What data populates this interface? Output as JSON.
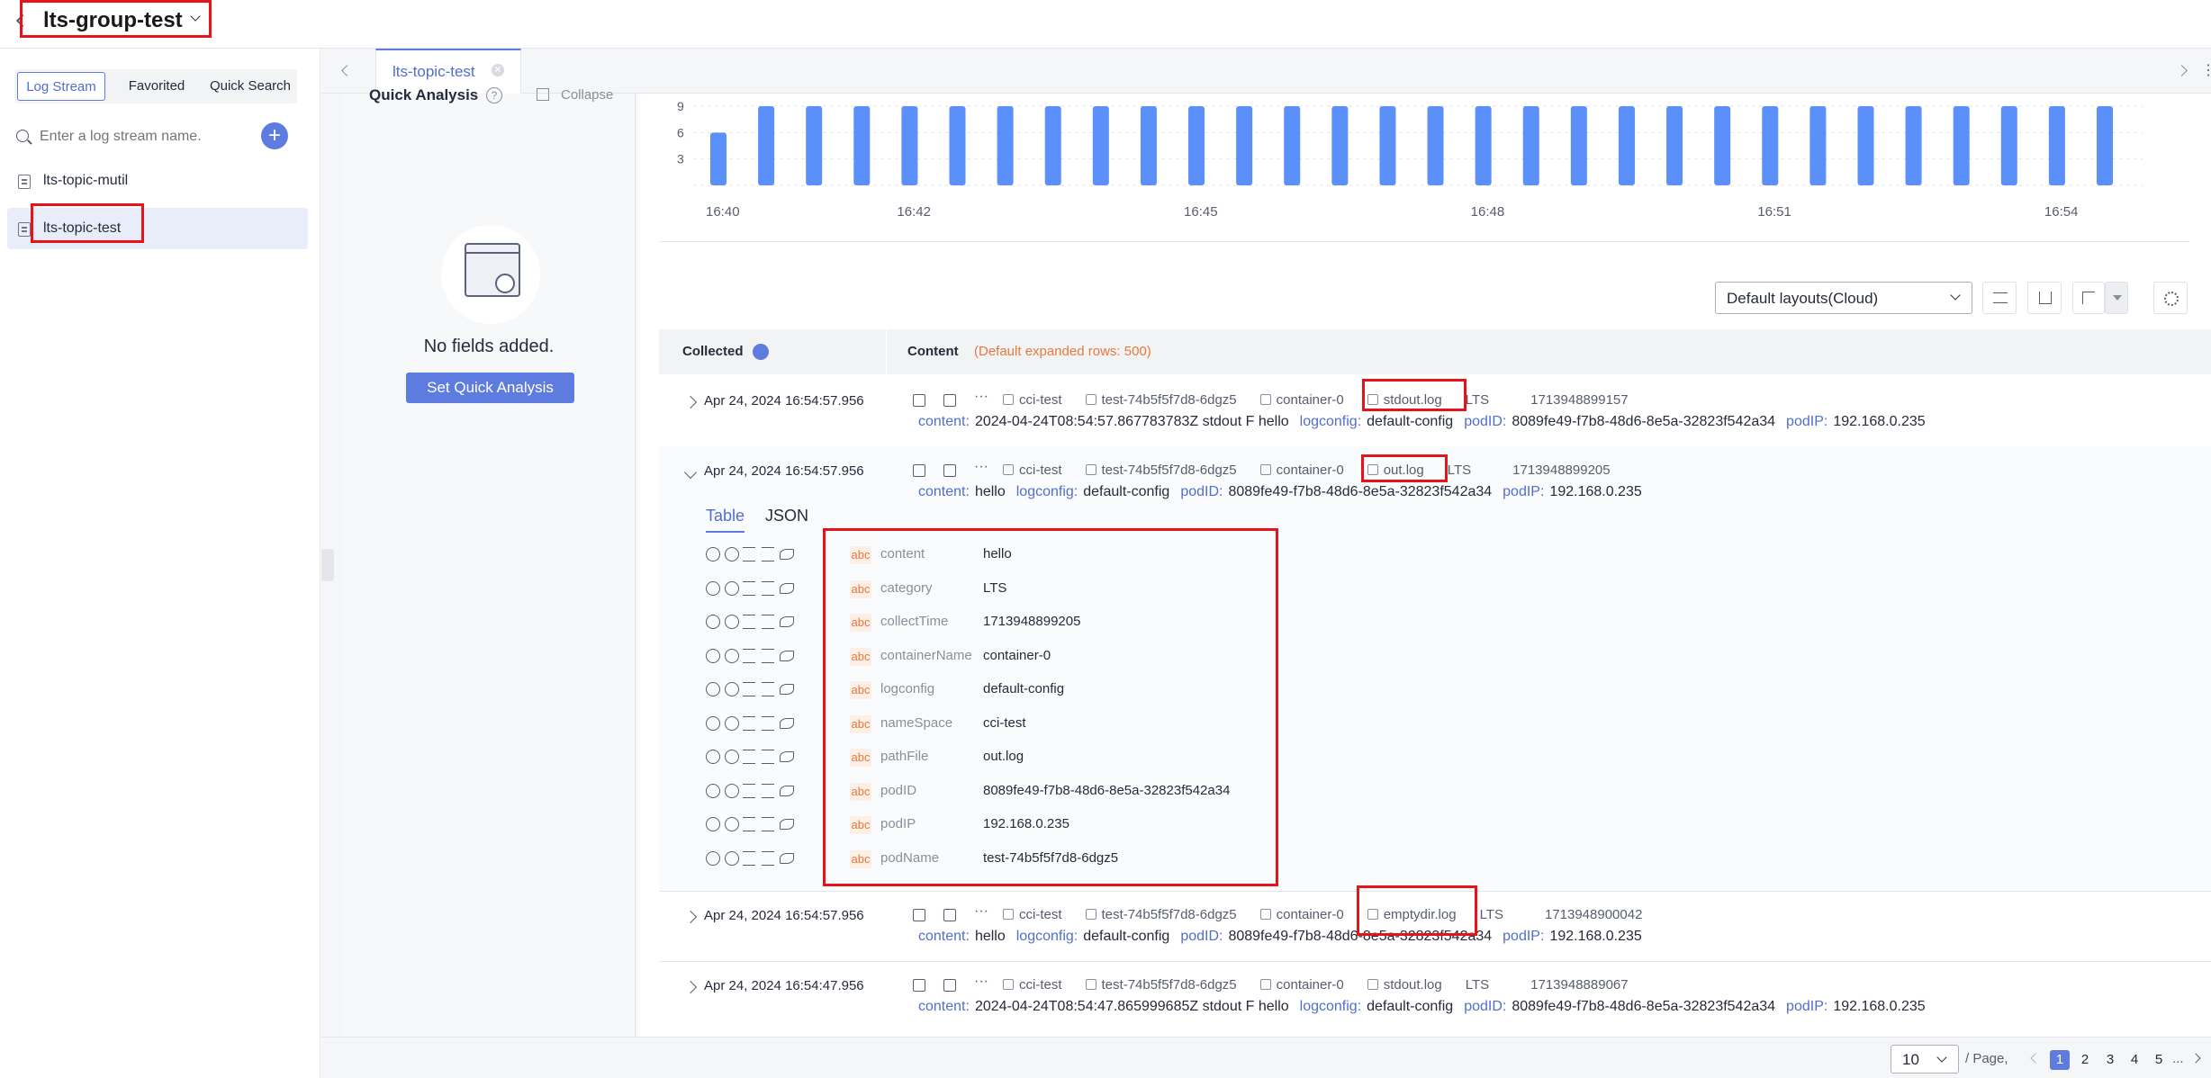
{
  "header": {
    "group_name": "lts-group-test"
  },
  "sidebar": {
    "tabs": [
      {
        "label": "Log Stream"
      },
      {
        "label": "Favorited"
      },
      {
        "label": "Quick Search"
      }
    ],
    "search_placeholder": "Enter a log stream name.",
    "streams": [
      {
        "label": "lts-topic-mutil"
      },
      {
        "label": "lts-topic-test"
      }
    ]
  },
  "tabs": {
    "active": "lts-topic-test"
  },
  "quick_analysis": {
    "title": "Quick Analysis",
    "collapse": "Collapse",
    "empty": "No fields added.",
    "button": "Set Quick Analysis"
  },
  "chart_data": {
    "type": "bar",
    "title": "",
    "xlabel": "",
    "ylabel": "",
    "ylim": [
      0,
      9
    ],
    "yticks": [
      "3",
      "6",
      "9"
    ],
    "xticks": [
      "16:40",
      "16:42",
      "16:45",
      "16:48",
      "16:51",
      "16:54"
    ],
    "values": [
      6,
      9,
      9,
      9,
      9,
      9,
      9,
      9,
      9,
      9,
      9,
      9,
      9,
      9,
      9,
      9,
      9,
      9,
      9,
      9,
      9,
      9,
      9,
      9,
      9,
      9,
      9,
      9,
      9,
      9
    ]
  },
  "toolbar": {
    "layout": "Default layouts(Cloud)"
  },
  "table": {
    "col_collected": "Collected",
    "col_content": "Content",
    "expanded_note": "(Default expanded rows: 500)"
  },
  "logs": [
    {
      "time": "Apr 24, 2024 16:54:57.956",
      "ns": "cci-test",
      "pod": "test-74b5f5f7d8-6dgz5",
      "container": "container-0",
      "file": "stdout.log",
      "cat": "LTS",
      "collect": "1713948899157",
      "content": "2024-04-24T08:54:57.867783783Z stdout F hello",
      "logconfig": "default-config",
      "podID": "8089fe49-f7b8-48d6-8e5a-32823f542a34",
      "podIP": "192.168.0.235"
    },
    {
      "time": "Apr 24, 2024 16:54:57.956",
      "ns": "cci-test",
      "pod": "test-74b5f5f7d8-6dgz5",
      "container": "container-0",
      "file": "out.log",
      "cat": "LTS",
      "collect": "1713948899205",
      "content": "hello",
      "logconfig": "default-config",
      "podID": "8089fe49-f7b8-48d6-8e5a-32823f542a34",
      "podIP": "192.168.0.235"
    },
    {
      "time": "Apr 24, 2024 16:54:57.956",
      "ns": "cci-test",
      "pod": "test-74b5f5f7d8-6dgz5",
      "container": "container-0",
      "file": "emptydir.log",
      "cat": "LTS",
      "collect": "1713948900042",
      "content": "hello",
      "logconfig": "default-config",
      "podID": "8089fe49-f7b8-48d6-8e5a-32823f542a34",
      "podIP": "192.168.0.235"
    },
    {
      "time": "Apr 24, 2024 16:54:47.956",
      "ns": "cci-test",
      "pod": "test-74b5f5f7d8-6dgz5",
      "container": "container-0",
      "file": "stdout.log",
      "cat": "LTS",
      "collect": "1713948889067",
      "content": "2024-04-24T08:54:47.865999685Z stdout F hello",
      "logconfig": "default-config",
      "podID": "8089fe49-f7b8-48d6-8e5a-32823f542a34",
      "podIP": "192.168.0.235"
    }
  ],
  "labels": {
    "content": "content:",
    "logconfig": "logconfig:",
    "podID": "podID:",
    "podIP": "podIP:"
  },
  "detail": {
    "tab_table": "Table",
    "tab_json": "JSON",
    "type_badge": "abc",
    "fields": [
      {
        "name": "content",
        "value": "hello"
      },
      {
        "name": "category",
        "value": "LTS"
      },
      {
        "name": "collectTime",
        "value": "1713948899205"
      },
      {
        "name": "containerName",
        "value": "container-0"
      },
      {
        "name": "logconfig",
        "value": "default-config"
      },
      {
        "name": "nameSpace",
        "value": "cci-test"
      },
      {
        "name": "pathFile",
        "value": "out.log"
      },
      {
        "name": "podID",
        "value": "8089fe49-f7b8-48d6-8e5a-32823f542a34"
      },
      {
        "name": "podIP",
        "value": "192.168.0.235"
      },
      {
        "name": "podName",
        "value": "test-74b5f5f7d8-6dgz5"
      }
    ]
  },
  "pagination": {
    "page_size": "10",
    "per_page": "/ Page,",
    "pages": [
      "1",
      "2",
      "3",
      "4",
      "5"
    ],
    "ellipsis": "..."
  },
  "colors": {
    "accent": "#5e7ce0",
    "bar": "#5b8ff9",
    "highlight": "#e4141b"
  }
}
